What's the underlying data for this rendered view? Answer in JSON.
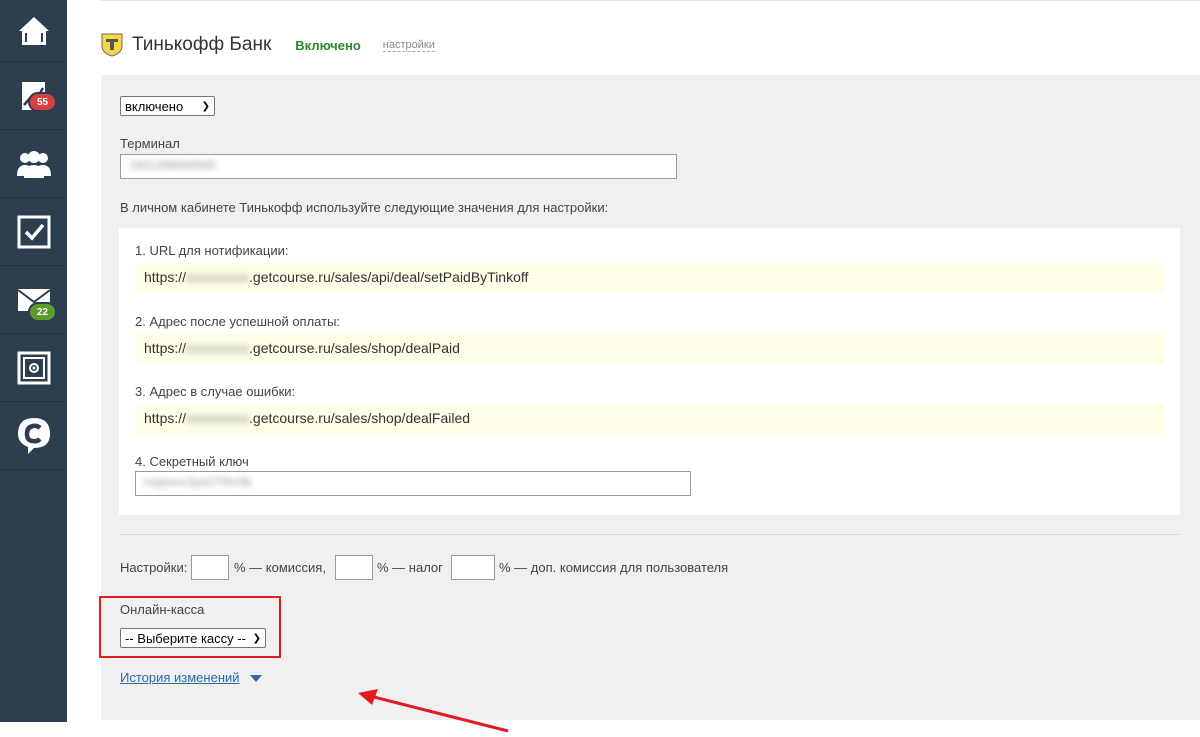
{
  "sidebar": {
    "items": [
      {
        "icon": "home-icon"
      },
      {
        "icon": "chart-icon",
        "badge": "55",
        "badge_color": "#d9413c"
      },
      {
        "icon": "users-icon"
      },
      {
        "icon": "checkbox-icon"
      },
      {
        "icon": "mail-icon",
        "badge": "22",
        "badge_color": "#5b9c2d"
      },
      {
        "icon": "safe-icon"
      },
      {
        "icon": "getcourse-logo-icon"
      }
    ]
  },
  "header": {
    "title": "Тинькофф Банк",
    "status": "Включено",
    "settings_link": "настройки"
  },
  "form": {
    "enabled_select": "включено",
    "terminal_label": "Терминал",
    "terminal_value": "1601288568585",
    "instructions": "В личном кабинете Тинькофф используйте следующие значения для настройки:",
    "notify_label": "1. URL для нотификации:",
    "notify_prefix": "https://",
    "notify_hidden": "xxxxxxxxx",
    "notify_suffix": ".getcourse.ru/sales/api/deal/setPaidByTinkoff",
    "success_label": "2. Адрес после успешной оплаты:",
    "success_prefix": "https://",
    "success_hidden": "xxxxxxxxx",
    "success_suffix": ".getcourse.ru/sales/shop/dealPaid",
    "fail_label": "3. Адрес в случае ошибки:",
    "fail_prefix": "https://",
    "fail_hidden": "xxxxxxxxx",
    "fail_suffix": ".getcourse.ru/sales/shop/dealFailed",
    "secret_label": "4. Секретный ключ",
    "secret_value": "rxqwxvc3yw27t5c0b",
    "settings_prefix": "Настройки:",
    "commission_label": "% — комиссия,",
    "tax_label": "% — налог",
    "user_commission_label": "% — доп. комиссия для пользователя",
    "kassa_label": "Онлайн-касса",
    "kassa_select": "-- Выберите кассу --",
    "history_link": "История изменений"
  },
  "colors": {
    "sidebar_bg": "#2d3e50",
    "status_green": "#2c8a2c",
    "highlight_box": "#e31b23",
    "link_blue": "#2a6aa8",
    "url_row_bg": "#fdfde8"
  }
}
